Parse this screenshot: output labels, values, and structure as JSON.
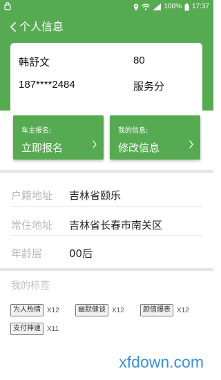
{
  "status_bar": {
    "battery": "100%",
    "time": "17:37",
    "icons": [
      "location-icon",
      "wifi-icon",
      "signal-icon",
      "battery-icon"
    ]
  },
  "header": {
    "title": "个人信息"
  },
  "profile": {
    "name": "韩舒文",
    "phone": "187****2484",
    "score": "80",
    "score_label": "服务分"
  },
  "actions": [
    {
      "caption": "车主报名:",
      "label": "立即报名"
    },
    {
      "caption": "我的信息:",
      "label": "修改信息"
    }
  ],
  "info_rows": [
    {
      "label": "户籍地址",
      "value": "吉林省颐乐"
    },
    {
      "label": "常住地址",
      "value": "吉林省长春市南关区"
    },
    {
      "label": "年龄层",
      "value": "00后"
    }
  ],
  "tags_section": {
    "title": "我的标签",
    "tags": [
      {
        "name": "为人热情",
        "count": "X12"
      },
      {
        "name": "幽默健谈",
        "count": "X12"
      },
      {
        "name": "颜值爆表",
        "count": "X12"
      },
      {
        "name": "支付神速",
        "count": "X11"
      }
    ]
  },
  "watermark": "xfdown.com",
  "colors": {
    "brand_green": "#56ab52",
    "divider": "#e6e6e6",
    "watermark_blue": "#3b8fd6"
  }
}
